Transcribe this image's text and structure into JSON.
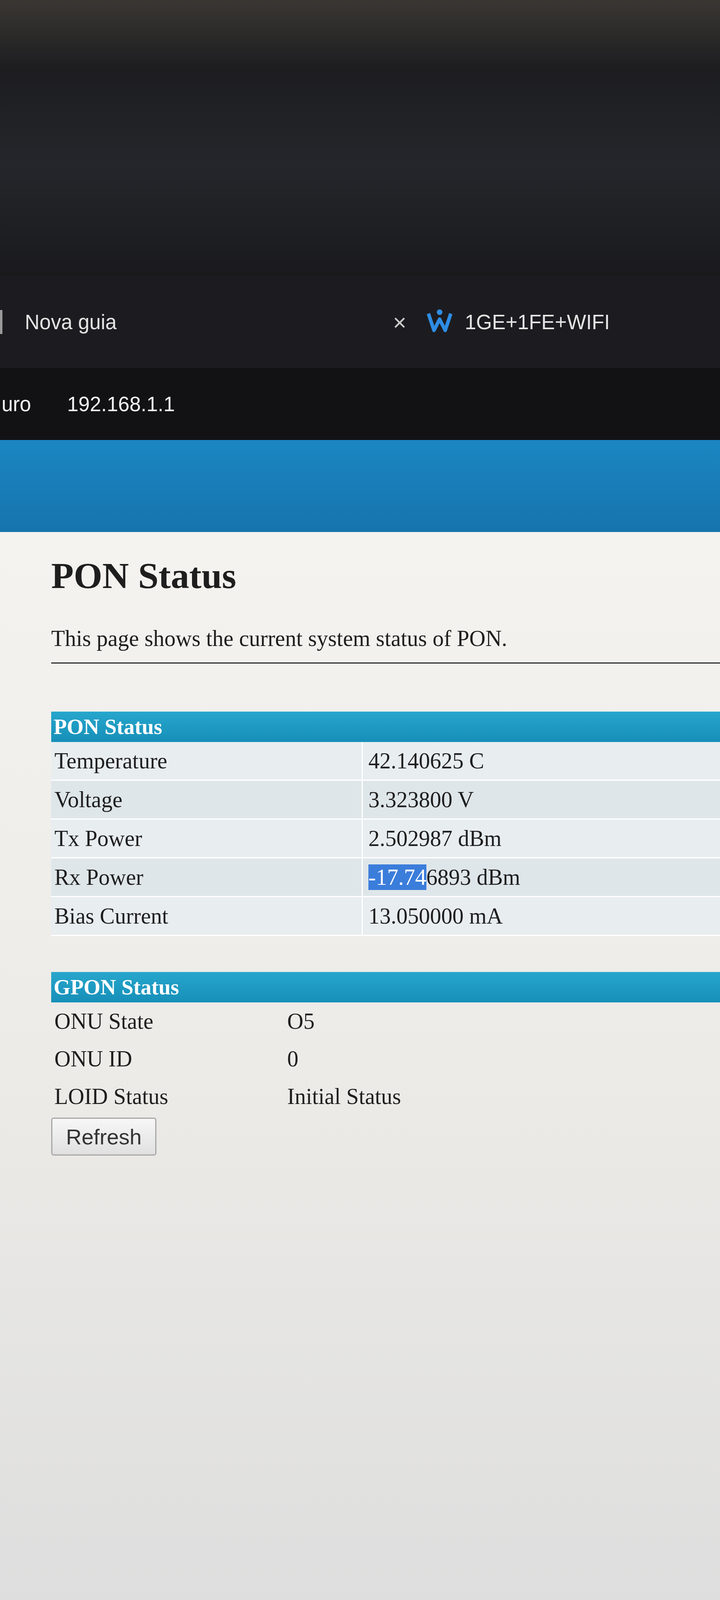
{
  "browser": {
    "tabs": [
      {
        "label": "Nova guia",
        "close": "×",
        "selected": false
      },
      {
        "label": "1GE+1FE+WIFI",
        "close": "",
        "selected": true
      }
    ],
    "address_prefix": "uro",
    "address": "192.168.1.1"
  },
  "page": {
    "title": "PON Status",
    "description": "This page shows the current system status of PON."
  },
  "pon_table": {
    "title": "PON Status",
    "rows": [
      {
        "label": "Temperature",
        "value": [
          {
            "text": "42.140625 C",
            "selected": false
          }
        ]
      },
      {
        "label": "Voltage",
        "value": [
          {
            "text": "3.323800 V",
            "selected": false
          }
        ]
      },
      {
        "label": "Tx Power",
        "value": [
          {
            "text": "2.502987 dBm",
            "selected": false
          }
        ]
      },
      {
        "label": "Rx Power",
        "value": [
          {
            "text": "-17.74",
            "selected": true
          },
          {
            "text": "6893 dBm",
            "selected": false
          }
        ]
      },
      {
        "label": "Bias Current",
        "value": [
          {
            "text": "13.050000 mA",
            "selected": false
          }
        ]
      }
    ]
  },
  "gpon_table": {
    "title": "GPON Status",
    "rows": [
      {
        "label": "ONU State",
        "value": "O5"
      },
      {
        "label": "ONU ID",
        "value": "0"
      },
      {
        "label": "LOID Status",
        "value": "Initial Status"
      }
    ]
  },
  "buttons": [
    "Refresh"
  ]
}
